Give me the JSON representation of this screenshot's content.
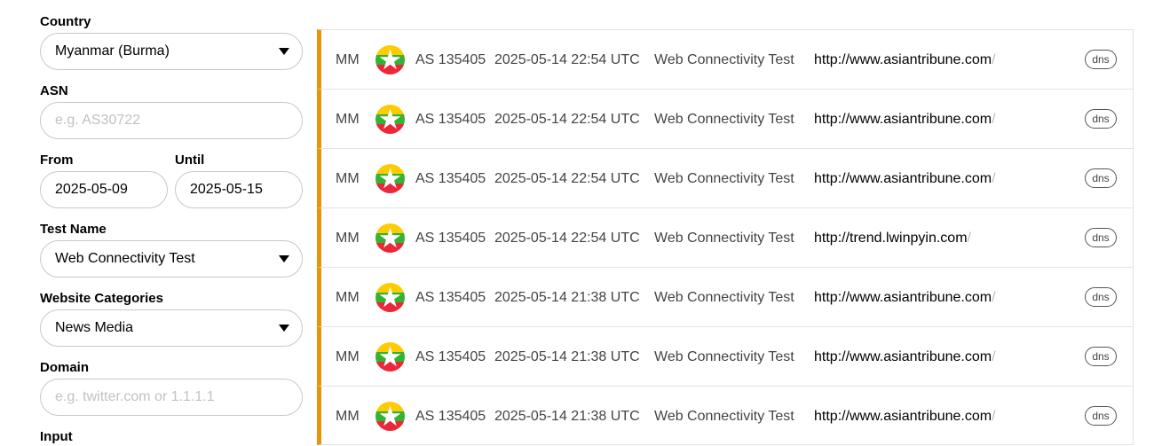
{
  "filters": {
    "country_label": "Country",
    "country_value": "Myanmar (Burma)",
    "asn_label": "ASN",
    "asn_placeholder": "e.g. AS30722",
    "from_label": "From",
    "from_value": "2025-05-09",
    "until_label": "Until",
    "until_value": "2025-05-15",
    "test_name_label": "Test Name",
    "test_name_value": "Web Connectivity Test",
    "categories_label": "Website Categories",
    "categories_value": "News Media",
    "domain_label": "Domain",
    "domain_placeholder": "e.g. twitter.com or 1.1.1.1",
    "input_label": "Input"
  },
  "results": [
    {
      "cc": "MM",
      "asn": "AS 135405",
      "time": "2025-05-14 22:54 UTC",
      "test": "Web Connectivity Test",
      "url": "http://www.asiantribune.com",
      "slash": "/",
      "badge": "dns"
    },
    {
      "cc": "MM",
      "asn": "AS 135405",
      "time": "2025-05-14 22:54 UTC",
      "test": "Web Connectivity Test",
      "url": "http://www.asiantribune.com",
      "slash": "/",
      "badge": "dns"
    },
    {
      "cc": "MM",
      "asn": "AS 135405",
      "time": "2025-05-14 22:54 UTC",
      "test": "Web Connectivity Test",
      "url": "http://www.asiantribune.com",
      "slash": "/",
      "badge": "dns"
    },
    {
      "cc": "MM",
      "asn": "AS 135405",
      "time": "2025-05-14 22:54 UTC",
      "test": "Web Connectivity Test",
      "url": "http://trend.lwinpyin.com",
      "slash": "/",
      "badge": "dns"
    },
    {
      "cc": "MM",
      "asn": "AS 135405",
      "time": "2025-05-14 21:38 UTC",
      "test": "Web Connectivity Test",
      "url": "http://www.asiantribune.com",
      "slash": "/",
      "badge": "dns"
    },
    {
      "cc": "MM",
      "asn": "AS 135405",
      "time": "2025-05-14 21:38 UTC",
      "test": "Web Connectivity Test",
      "url": "http://www.asiantribune.com",
      "slash": "/",
      "badge": "dns"
    },
    {
      "cc": "MM",
      "asn": "AS 135405",
      "time": "2025-05-14 21:38 UTC",
      "test": "Web Connectivity Test",
      "url": "http://www.asiantribune.com",
      "slash": "/",
      "badge": "dns"
    }
  ],
  "colors": {
    "accent": "#e8930c",
    "flag_yellow": "#fecb00",
    "flag_green": "#34b233",
    "flag_red": "#ea2839"
  }
}
